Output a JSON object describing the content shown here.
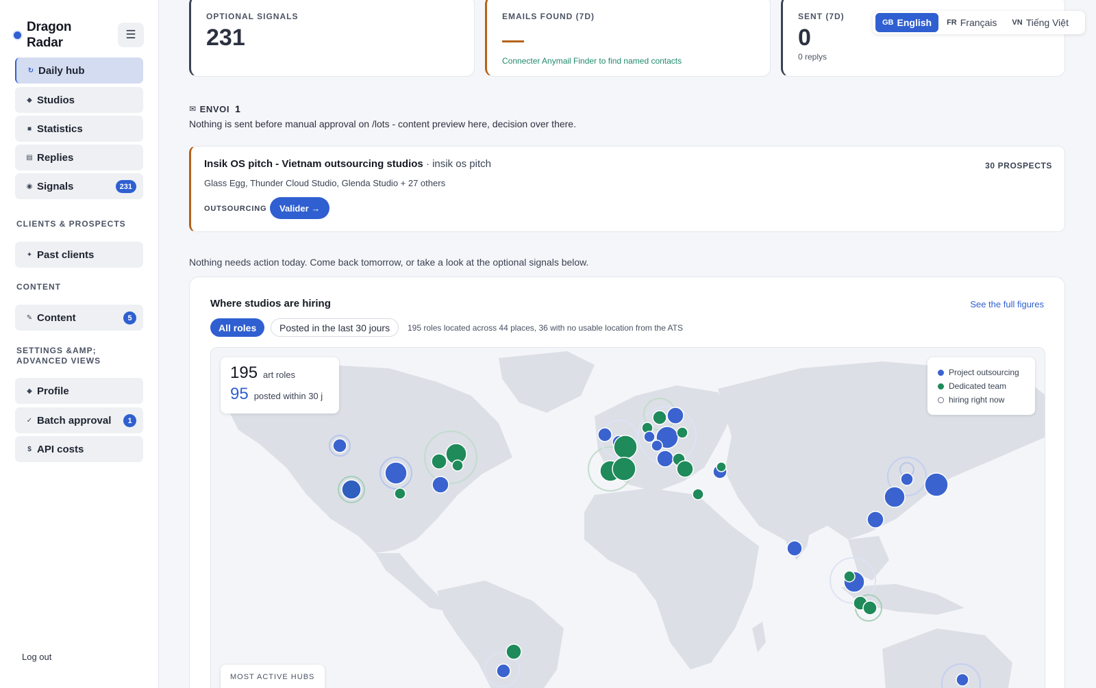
{
  "brand": {
    "name_line1": "Dragon",
    "name_line2": "Radar"
  },
  "nav": {
    "menu_icon": "hamburger-icon",
    "items": [
      {
        "label": "Daily hub",
        "icon": "refresh-icon",
        "glyph": "↻",
        "active": true
      },
      {
        "label": "Studios",
        "icon": "diamond-icon",
        "glyph": "◆"
      },
      {
        "label": "Statistics",
        "icon": "bar-icon",
        "glyph": "■"
      },
      {
        "label": "Replies",
        "icon": "inbox-icon",
        "glyph": "▤"
      },
      {
        "label": "Signals",
        "icon": "radar-icon",
        "glyph": "◉",
        "badge": "231"
      }
    ],
    "section_clients": "CLIENTS & PROSPECTS",
    "clients_items": [
      {
        "label": "Past clients",
        "glyph": "✦"
      }
    ],
    "section_content": "CONTENT",
    "content_items": [
      {
        "label": "Content",
        "glyph": "✎",
        "badge": "5"
      }
    ],
    "section_settings": "SETTINGS &AMP; ADVANCED VIEWS",
    "settings_items": [
      {
        "label": "Profile",
        "glyph": "◆"
      },
      {
        "label": "Batch approval",
        "glyph": "✓",
        "badge": "1"
      },
      {
        "label": "API costs",
        "glyph": "$"
      }
    ],
    "logout": "Log out"
  },
  "stats": {
    "optional_signals": {
      "label": "OPTIONAL SIGNALS",
      "value": "231"
    },
    "emails_found": {
      "label": "EMAILS FOUND (7D)",
      "link": "Connecter Anymail Finder to find named contacts"
    },
    "sent": {
      "label": "SENT (7D)",
      "value": "0",
      "sub": "0 replys"
    }
  },
  "languages": [
    {
      "code": "GB",
      "label": "English",
      "active": true
    },
    {
      "code": "FR",
      "label": "Français"
    },
    {
      "code": "VN",
      "label": "Tiếng Việt"
    }
  ],
  "envoi": {
    "title": "ENVOI",
    "count": "1",
    "note": "Nothing is sent before manual approval on /lots - content preview here, decision over there.",
    "campaign": {
      "title": "Insik OS pitch - Vietnam outsourcing studios",
      "subtitle": "· insik os pitch",
      "prospects": "30 PROSPECTS",
      "studios": "Glass Egg, Thunder Cloud Studio, Glenda Studio + 27 others",
      "tag": "OUTSOURCING",
      "button": "Valider →"
    }
  },
  "no_action_note": "Nothing needs action today. Come back tomorrow, or take a look at the optional signals below.",
  "map": {
    "title": "Where studios are hiring",
    "link": "See the full figures",
    "chips": {
      "all": "All roles",
      "recent": "Posted in the last 30 jours"
    },
    "summary": "195 roles located across 44 places, 36 with no usable location from the ATS",
    "overlay": {
      "total": "195",
      "total_label": "art roles",
      "recent": "95",
      "recent_label": "posted within 30 j"
    },
    "legend": [
      {
        "label": "Project outsourcing",
        "color": "#3b63cf"
      },
      {
        "label": "Dedicated team",
        "color": "#1f8a5a"
      },
      {
        "label": "hiring right now",
        "color": ""
      }
    ],
    "hubs_label": "MOST ACTIVE HUBS",
    "colors": {
      "blue": "#3b63cf",
      "green": "#1f8a5a",
      "land": "#dcdfe6"
    }
  }
}
